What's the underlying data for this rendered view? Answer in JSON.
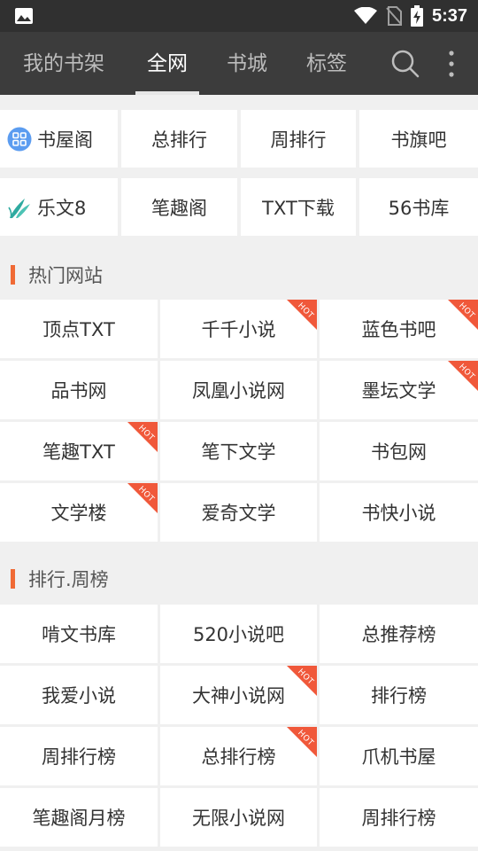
{
  "status_bar": {
    "time": "5:37"
  },
  "app_bar": {
    "tabs": [
      {
        "label": "我的书架"
      },
      {
        "label": "全网"
      },
      {
        "label": "书城"
      },
      {
        "label": "标签"
      }
    ],
    "active_tab": "全网"
  },
  "quick_links": {
    "row1": [
      {
        "label": "书屋阁",
        "icon": "grid-app-icon"
      },
      {
        "label": "总排行"
      },
      {
        "label": "周排行"
      },
      {
        "label": "书旗吧"
      }
    ],
    "row2": [
      {
        "label": "乐文8",
        "icon": "leaf-logo-icon"
      },
      {
        "label": "笔趣阁"
      },
      {
        "label": "TXT下载"
      },
      {
        "label": "56书库"
      }
    ]
  },
  "hot_sites": {
    "title": "热门网站",
    "items": [
      {
        "label": "顶点TXT",
        "hot": false
      },
      {
        "label": "千千小说",
        "hot": true
      },
      {
        "label": "蓝色书吧",
        "hot": true
      },
      {
        "label": "品书网",
        "hot": false
      },
      {
        "label": "凤凰小说网",
        "hot": false
      },
      {
        "label": "墨坛文学",
        "hot": true
      },
      {
        "label": "笔趣TXT",
        "hot": true
      },
      {
        "label": "笔下文学",
        "hot": false
      },
      {
        "label": "书包网",
        "hot": false
      },
      {
        "label": "文学楼",
        "hot": true
      },
      {
        "label": "爱奇文学",
        "hot": false
      },
      {
        "label": "书快小说",
        "hot": false
      }
    ]
  },
  "rankings": {
    "title": "排行.周榜",
    "items": [
      {
        "label": "啃文书库",
        "hot": false
      },
      {
        "label": "520小说吧",
        "hot": false
      },
      {
        "label": "总推荐榜",
        "hot": false
      },
      {
        "label": "我爱小说",
        "hot": false
      },
      {
        "label": "大神小说网",
        "hot": true
      },
      {
        "label": "排行榜",
        "hot": false
      },
      {
        "label": "周排行榜",
        "hot": false
      },
      {
        "label": "总排行榜",
        "hot": true
      },
      {
        "label": "爪机书屋",
        "hot": false
      },
      {
        "label": "笔趣阁月榜",
        "hot": false
      },
      {
        "label": "无限小说网",
        "hot": false
      },
      {
        "label": "周排行榜",
        "hot": false
      }
    ]
  },
  "hot_badge_text": "HOT",
  "colors": {
    "app_bar": "#3c3c3c",
    "status_bar": "#303030",
    "accent": "#f06a35",
    "hot_badge": "#f0583a"
  }
}
